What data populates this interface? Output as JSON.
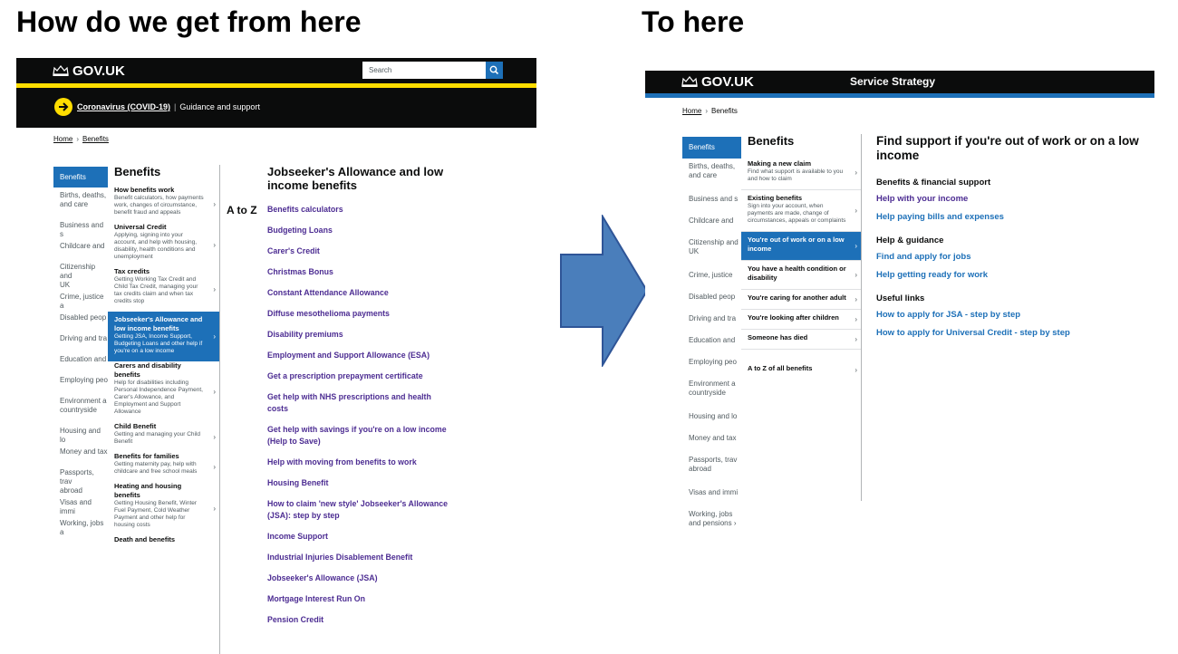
{
  "slide": {
    "left_title": "How do we get from here",
    "right_title": "To here"
  },
  "left": {
    "logo": "GOV.UK",
    "search_placeholder": "Search",
    "covid_link": "Coronavirus (COVID-19)",
    "covid_sep": "|",
    "covid_text": "Guidance and support",
    "breadcrumb": [
      "Home",
      "Benefits"
    ],
    "side_nav": [
      {
        "label": "Benefits",
        "active": true,
        "two": false
      },
      {
        "label": "Births, deaths,\nand care",
        "two": true
      },
      {
        "label": "Business and s",
        "two": false
      },
      {
        "label": "Childcare and",
        "two": false
      },
      {
        "label": "Citizenship and\nUK",
        "two": true
      },
      {
        "label": "Crime, justice a",
        "two": false
      },
      {
        "label": "Disabled peop",
        "two": false
      },
      {
        "label": "Driving and tra",
        "two": false
      },
      {
        "label": "Education and",
        "two": false
      },
      {
        "label": "Employing peo",
        "two": false
      },
      {
        "label": "Environment a\ncountryside",
        "two": true
      },
      {
        "label": "Housing and lo",
        "two": false
      },
      {
        "label": "Money and tax",
        "two": false
      },
      {
        "label": "Passports, trav\nabroad",
        "two": true
      },
      {
        "label": "Visas and immi",
        "two": false
      },
      {
        "label": "Working, jobs a",
        "two": false
      }
    ],
    "categories_heading": "Benefits",
    "categories": [
      {
        "title": "How benefits work",
        "desc": "Benefit calculators, how payments work, changes of circumstance, benefit fraud and appeals"
      },
      {
        "title": "Universal Credit",
        "desc": "Applying, signing into your account, and help with housing, disability, health conditions and unemployment"
      },
      {
        "title": "Tax credits",
        "desc": "Getting Working Tax Credit and Child Tax Credit, managing your tax credits claim and when tax credits stop"
      },
      {
        "title": "Jobseeker's Allowance and low income benefits",
        "desc": "Getting JSA, Income Support, Budgeting Loans and other help if you're on a low income",
        "active": true
      },
      {
        "title": "Carers and disability benefits",
        "desc": "Help for disabilities including Personal Independence Payment, Carer's Allowance, and Employment and Support Allowance"
      },
      {
        "title": "Child Benefit",
        "desc": "Getting and managing your Child Benefit"
      },
      {
        "title": "Benefits for families",
        "desc": "Getting maternity pay, help with childcare and free school meals"
      },
      {
        "title": "Heating and housing benefits",
        "desc": "Getting Housing Benefit, Winter Fuel Payment, Cold Weather Payment and other help for housing costs"
      },
      {
        "title": "Death and benefits",
        "desc": ""
      }
    ],
    "atoz": "A to Z",
    "links_heading": "Jobseeker's Allowance and low income benefits",
    "links": [
      "Benefits calculators",
      "Budgeting Loans",
      "Carer's Credit",
      "Christmas Bonus",
      "Constant Attendance Allowance",
      "Diffuse mesothelioma payments",
      "Disability premiums",
      "Employment and Support Allowance (ESA)",
      "Get a prescription prepayment certificate",
      "Get help with NHS prescriptions and health costs",
      "Get help with savings if you're on a low income (Help to Save)",
      "Help with moving from benefits to work",
      "Housing Benefit",
      "How to claim 'new style' Jobseeker's Allowance (JSA): step by step",
      "Income Support",
      "Industrial Injuries Disablement Benefit",
      "Jobseeker's Allowance (JSA)",
      "Mortgage Interest Run On",
      "Pension Credit"
    ]
  },
  "right": {
    "logo": "GOV.UK",
    "service_name": "Service Strategy",
    "breadcrumb": [
      "Home",
      "Benefits"
    ],
    "side_nav": [
      {
        "label": "Benefits",
        "active": true,
        "two": false
      },
      {
        "label": "Births, deaths,\nand care",
        "two": true
      },
      {
        "label": "Business and s",
        "two": false
      },
      {
        "label": "Childcare and",
        "two": false
      },
      {
        "label": "Citizenship and\nUK",
        "two": true
      },
      {
        "label": "Crime, justice",
        "two": false
      },
      {
        "label": "Disabled peop",
        "two": false
      },
      {
        "label": "Driving and tra",
        "two": false
      },
      {
        "label": "Education and",
        "two": false
      },
      {
        "label": "Employing peo",
        "two": false
      },
      {
        "label": "Environment a\ncountryside",
        "two": true
      },
      {
        "label": "Housing and lo",
        "two": false
      },
      {
        "label": "Money and tax",
        "two": false
      },
      {
        "label": "Passports, trav\nabroad",
        "two": true
      },
      {
        "label": "Visas and immi",
        "two": false
      },
      {
        "label": "Working, jobs and pensions  ›",
        "two": false
      }
    ],
    "categories_heading": "Benefits",
    "categories": [
      {
        "title": "Making a new claim",
        "desc": "Find what support is available to you and how to claim"
      },
      {
        "title": "Existing benefits",
        "desc": "Sign into your account, when payments are made, change of circumstances, appeals or complaints"
      },
      {
        "title": "You're out of work or on a low income",
        "desc": "",
        "active": true
      },
      {
        "title": "You have a health condition or disability",
        "desc": ""
      },
      {
        "title": "You're caring for another adult",
        "desc": ""
      },
      {
        "title": "You're looking after children",
        "desc": ""
      },
      {
        "title": "Someone has died",
        "desc": ""
      },
      {
        "title": "A to Z of all benefits",
        "desc": "",
        "gap": true
      }
    ],
    "main_heading": "Find support if you're out of work or on a low income",
    "sections": [
      {
        "title": "Benefits & financial support",
        "links": [
          "Help with your income",
          "Help paying bills and expenses"
        ]
      },
      {
        "title": "Help & guidance",
        "links": [
          "Find and apply for jobs",
          "Help getting ready for work"
        ]
      },
      {
        "title": "Useful links",
        "links": [
          "How to apply for JSA - step by step",
          "How to apply for Universal Credit - step by step"
        ]
      }
    ]
  },
  "colors": {
    "gov_black": "#0b0c0c",
    "gov_yellow": "#ffdd00",
    "gov_blue": "#1d70b8",
    "link_purple": "#4c2c92",
    "arrow_fill": "#4a7ebb",
    "arrow_stroke": "#2f5597"
  },
  "icons": {
    "crown": "crown-icon",
    "search": "search-icon",
    "chevron": "chevron-right-icon",
    "arrow": "arrow-right-icon",
    "covid": "arrow-circle-icon"
  }
}
